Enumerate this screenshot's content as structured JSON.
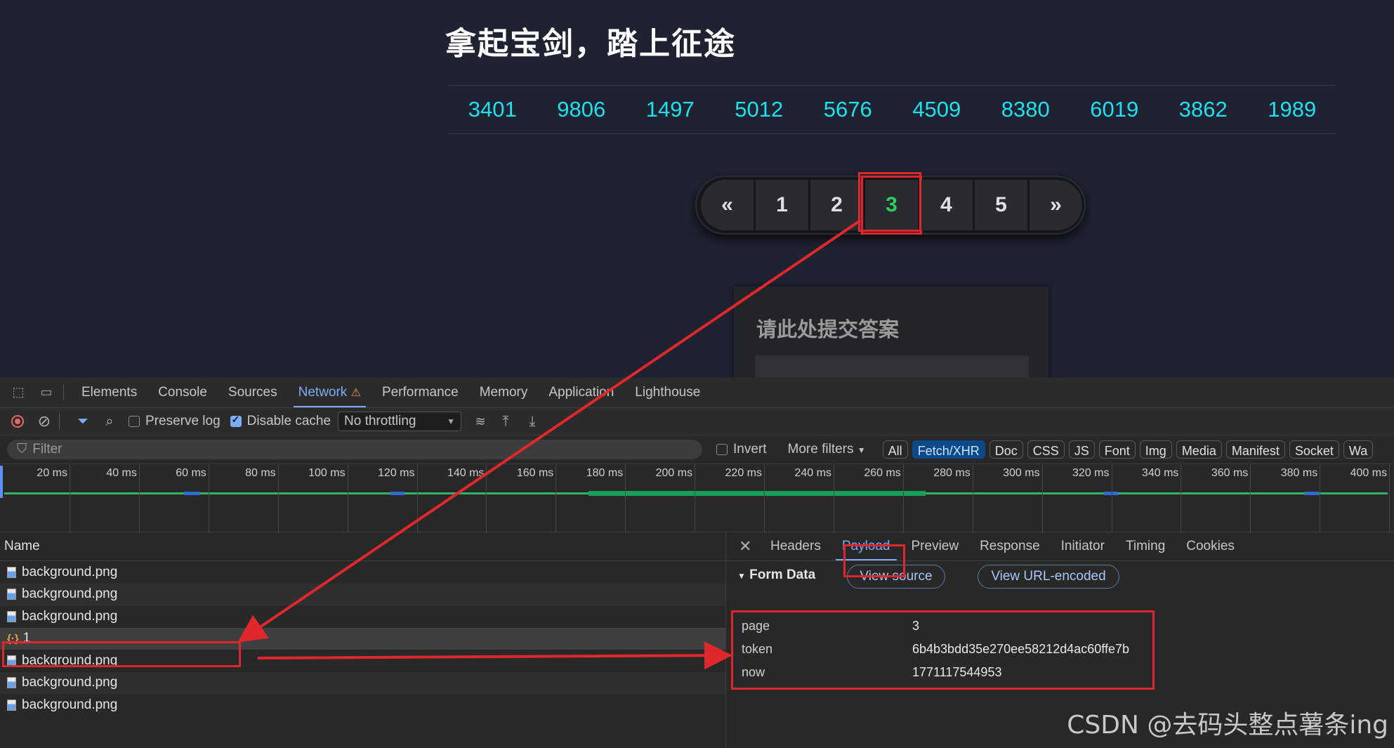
{
  "page": {
    "title": "拿起宝剑，踏上征途",
    "numbers": [
      "3401",
      "9806",
      "1497",
      "5012",
      "5676",
      "4509",
      "8380",
      "6019",
      "3862",
      "1989"
    ],
    "pager": [
      "«",
      "1",
      "2",
      "3",
      "4",
      "5",
      "»"
    ],
    "pager_active": "3",
    "answer_title": "请此处提交答案"
  },
  "devtools": {
    "tabs": [
      "Elements",
      "Console",
      "Sources",
      "Network",
      "Performance",
      "Memory",
      "Application",
      "Lighthouse"
    ],
    "selected_tab": "Network",
    "toolbar": {
      "preserve_log": "Preserve log",
      "disable_cache": "Disable cache",
      "throttling": "No throttling"
    },
    "filter": {
      "placeholder": "Filter",
      "invert": "Invert",
      "more_filters": "More filters",
      "types": [
        "All",
        "Fetch/XHR",
        "Doc",
        "CSS",
        "JS",
        "Font",
        "Img",
        "Media",
        "Manifest",
        "Socket",
        "Wa"
      ],
      "selected_type": "Fetch/XHR"
    },
    "timeline_ticks": [
      "20 ms",
      "40 ms",
      "60 ms",
      "80 ms",
      "100 ms",
      "120 ms",
      "140 ms",
      "160 ms",
      "180 ms",
      "200 ms",
      "220 ms",
      "240 ms",
      "260 ms",
      "280 ms",
      "300 ms",
      "320 ms",
      "340 ms",
      "360 ms",
      "380 ms",
      "400 ms"
    ],
    "list_header": "Name",
    "requests": [
      {
        "name": "background.png",
        "type": "img"
      },
      {
        "name": "background.png",
        "type": "img"
      },
      {
        "name": "background.png",
        "type": "img"
      },
      {
        "name": "1",
        "type": "xhr"
      },
      {
        "name": "background.png",
        "type": "img"
      },
      {
        "name": "background.png",
        "type": "img"
      },
      {
        "name": "background.png",
        "type": "img"
      }
    ],
    "detail_tabs": [
      "Headers",
      "Payload",
      "Preview",
      "Response",
      "Initiator",
      "Timing",
      "Cookies"
    ],
    "selected_detail_tab": "Payload",
    "form_data": {
      "label": "Form Data",
      "view_source": "View source",
      "view_url_encoded": "View URL-encoded",
      "rows": [
        {
          "key": "page",
          "value": "3"
        },
        {
          "key": "token",
          "value": "6b4b3bdd35e270ee58212d4ac60ffe7b"
        },
        {
          "key": "now",
          "value": "1771117544953"
        }
      ]
    }
  },
  "watermark": "CSDN @去码头整点薯条ing",
  "colors": {
    "annotation": "#e0282c",
    "number": "#1ee0ef",
    "active_page": "#2fcf5f",
    "accent": "#7cacf8"
  }
}
